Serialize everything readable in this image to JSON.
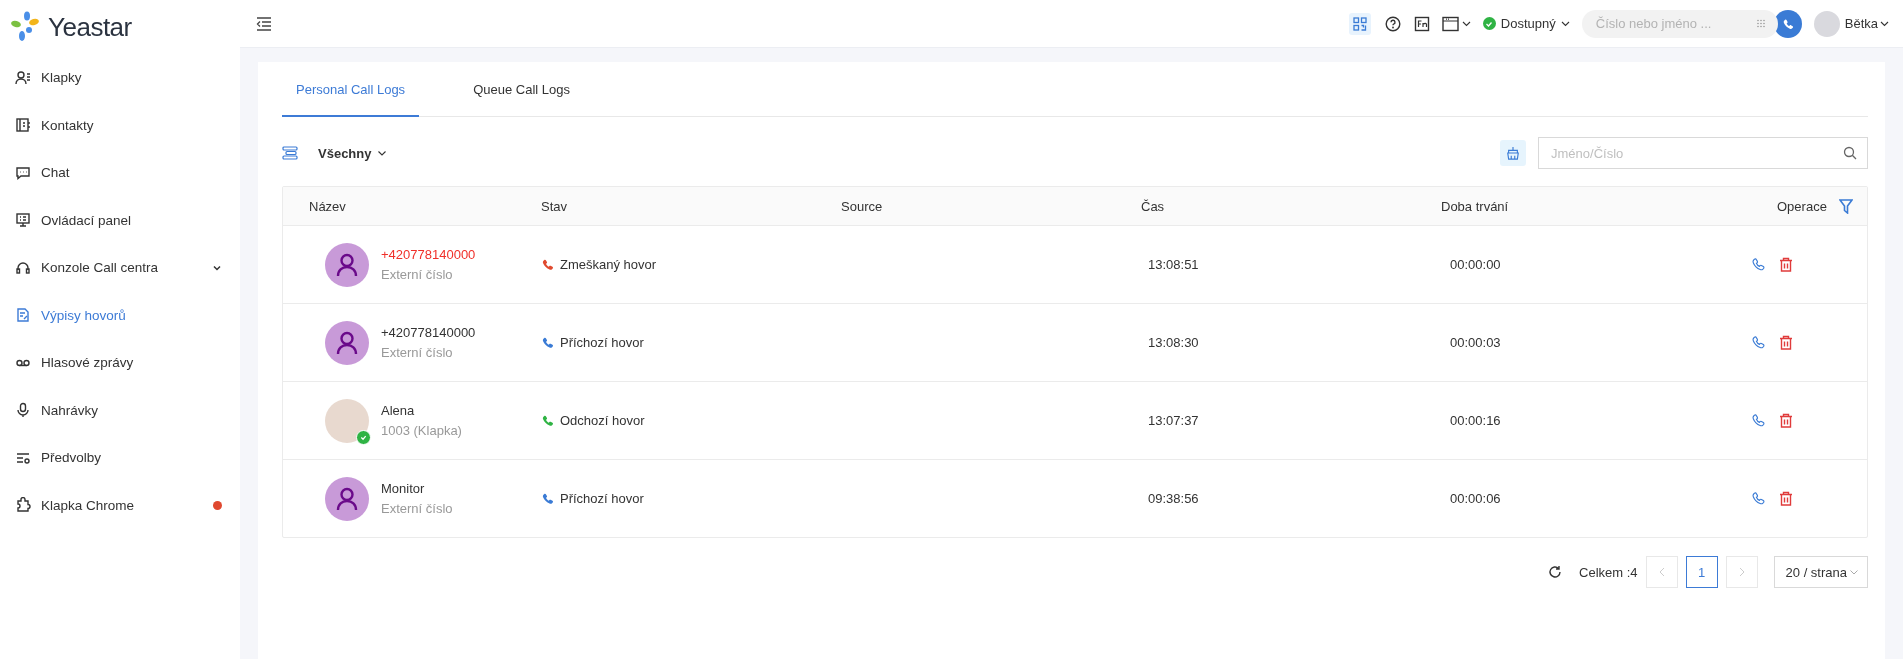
{
  "sidebar": {
    "logo": "Yeastar",
    "items": [
      {
        "label": "Klapky",
        "selected": false,
        "expandable": false,
        "notification": false
      },
      {
        "label": "Kontakty",
        "selected": false,
        "expandable": false,
        "notification": false
      },
      {
        "label": "Chat",
        "selected": false,
        "expandable": false,
        "notification": false
      },
      {
        "label": "Ovládací panel",
        "selected": false,
        "expandable": false,
        "notification": false
      },
      {
        "label": "Konzole Call centra",
        "selected": false,
        "expandable": true,
        "notification": false
      },
      {
        "label": "Výpisy hovorů",
        "selected": true,
        "expandable": false,
        "notification": false
      },
      {
        "label": "Hlasové zprávy",
        "selected": false,
        "expandable": false,
        "notification": false
      },
      {
        "label": "Nahrávky",
        "selected": false,
        "expandable": false,
        "notification": false
      },
      {
        "label": "Předvolby",
        "selected": false,
        "expandable": false,
        "notification": false
      },
      {
        "label": "Klapka Chrome",
        "selected": false,
        "expandable": false,
        "notification": true
      }
    ]
  },
  "topbar": {
    "presence": {
      "label": "Dostupný",
      "color": "#2fb344"
    },
    "dial_field": {
      "placeholder": "Číslo nebo jméno ..."
    },
    "user": {
      "name": "Bětka"
    }
  },
  "tabs": [
    {
      "label": "Personal Call Logs",
      "selected": true
    },
    {
      "label": "Queue Call Logs",
      "selected": false
    }
  ],
  "filter": {
    "label": "Všechny"
  },
  "search": {
    "placeholder": "Jméno/Číslo"
  },
  "table": {
    "columns": [
      "Název",
      "Stav",
      "Source",
      "Čas",
      "Doba trvání",
      "Operace"
    ],
    "rows": [
      {
        "name": "+420778140000",
        "detail": "Externí číslo",
        "has_photo": false,
        "online": false,
        "kind": "missed",
        "status": "Zmeškaný hovor",
        "time": "13:08:51",
        "duration": "00:00:00"
      },
      {
        "name": "+420778140000",
        "detail": "Externí číslo",
        "has_photo": false,
        "online": false,
        "kind": "incoming",
        "status": "Příchozí hovor",
        "time": "13:08:30",
        "duration": "00:00:03"
      },
      {
        "name": "Alena",
        "detail": "1003 (Klapka)",
        "has_photo": true,
        "online": true,
        "kind": "outgoing",
        "status": "Odchozí hovor",
        "time": "13:07:37",
        "duration": "00:00:16"
      },
      {
        "name": "Monitor",
        "detail": "Externí číslo",
        "has_photo": false,
        "online": false,
        "kind": "incoming",
        "status": "Příchozí hovor",
        "time": "09:38:56",
        "duration": "00:00:06"
      }
    ]
  },
  "pagination": {
    "total": "Celkem :4",
    "pages": [
      {
        "label": "1",
        "selected": true
      }
    ],
    "page_size": "20 / strana"
  }
}
